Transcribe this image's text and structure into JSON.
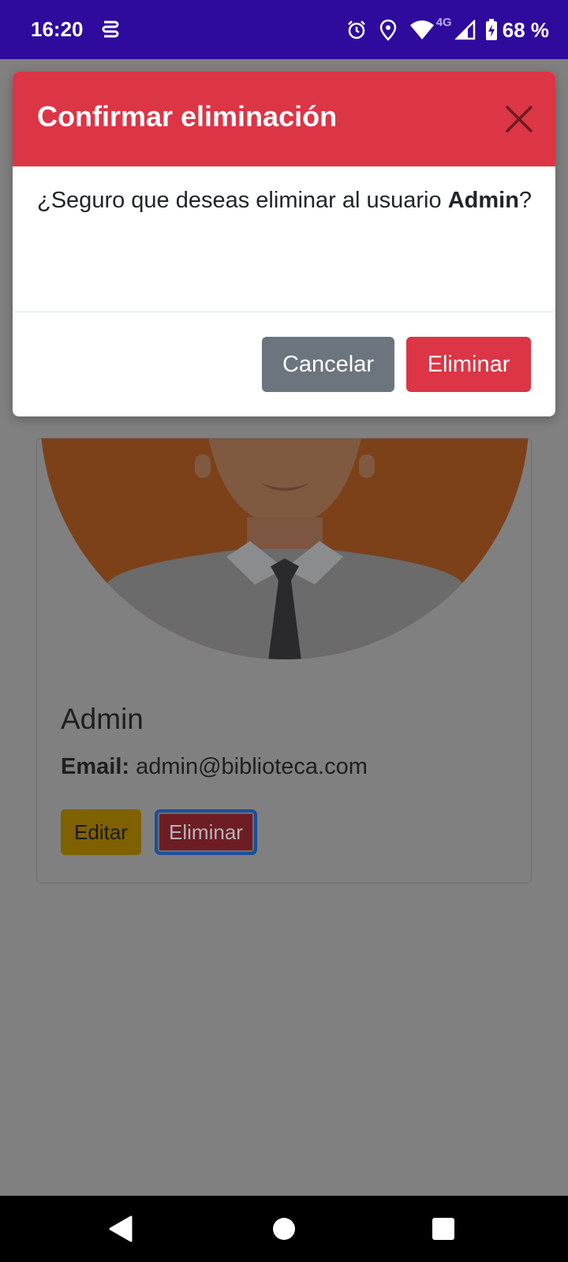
{
  "status_bar": {
    "time": "16:20",
    "network_type": "4G",
    "battery_percent": "68 %"
  },
  "icons": {
    "app_notification": "s-app-icon",
    "alarm": "alarm-icon",
    "location": "location-icon",
    "wifi": "wifi-icon",
    "signal": "signal-icon",
    "battery": "battery-charging-icon"
  },
  "user_card": {
    "name": "Admin",
    "email_label": "Email:",
    "email_value": "admin@biblioteca.com",
    "edit_label": "Editar",
    "delete_label": "Eliminar"
  },
  "modal": {
    "title": "Confirmar eliminación",
    "message_prefix": "¿Seguro que deseas eliminar al usuario ",
    "message_user": "Admin",
    "message_suffix": "?",
    "cancel_label": "Cancelar",
    "confirm_label": "Eliminar"
  },
  "colors": {
    "status_bar": "#2e0b9c",
    "danger": "#dc3545",
    "secondary": "#6c757d",
    "overlay_bg": "#808080"
  }
}
